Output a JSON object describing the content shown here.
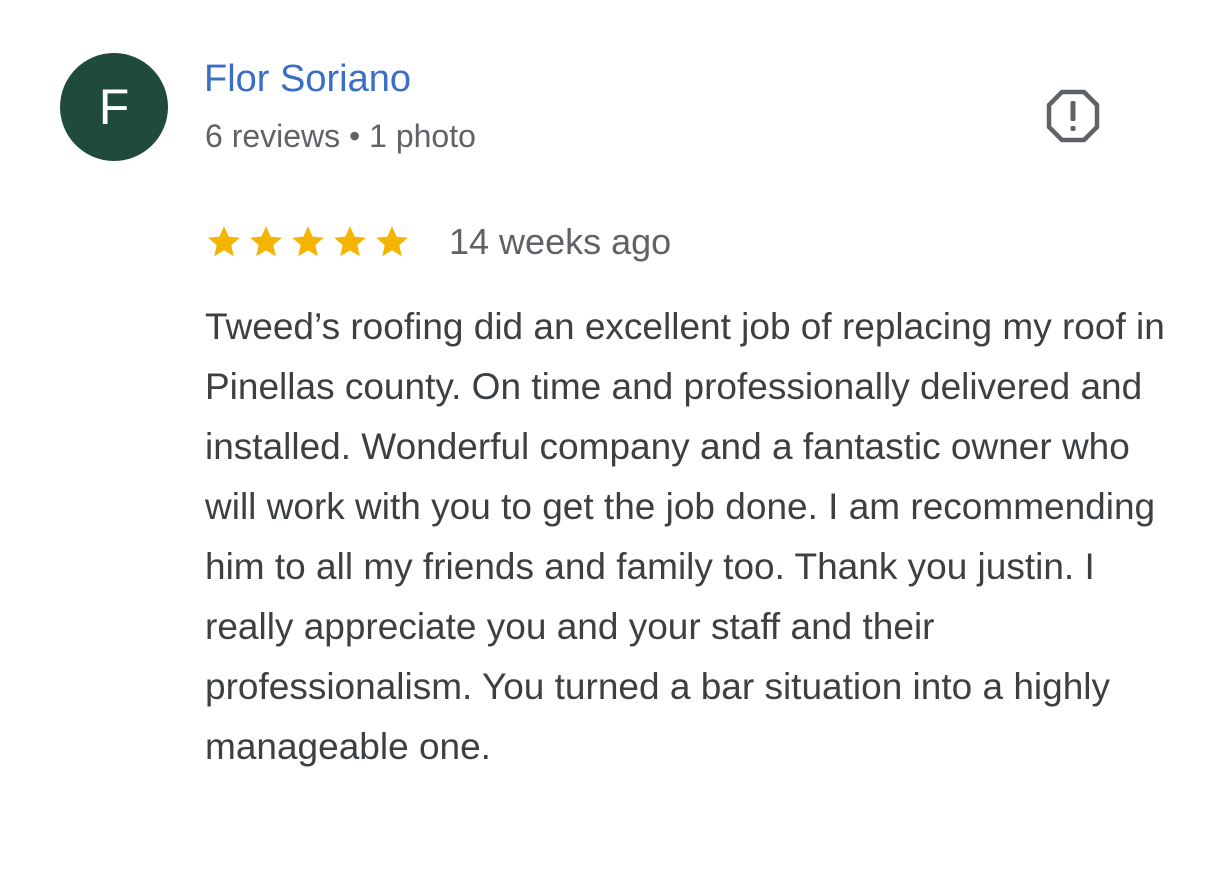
{
  "reviewer": {
    "initial": "F",
    "name": "Flor Soriano",
    "meta": "6 reviews • 1 photo",
    "avatar_color": "#1f4a3c",
    "name_color": "#3b6fc6"
  },
  "report": {
    "icon": "report-flag-icon"
  },
  "review": {
    "rating": 5,
    "rating_max": 5,
    "star_color": "#f4b400",
    "time": "14 weeks ago",
    "text": "Tweed’s roofing did an excellent job of replacing my roof in Pinellas county. On time and professionally delivered and installed. Wonderful company and a fantastic owner who will work with you to get the job done. I am recommending him to all my friends and family too. Thank you justin. I really appreciate you and your staff and their professionalism. You turned a bar situation into a highly manageable one."
  }
}
